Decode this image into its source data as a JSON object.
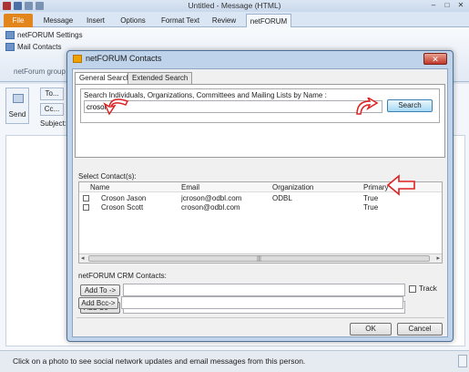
{
  "window": {
    "title": "Untitled - Message (HTML)",
    "controls": [
      "–",
      "□",
      "✕"
    ]
  },
  "ribbon": {
    "tabs": [
      "File",
      "Message",
      "Insert",
      "Options",
      "Format Text",
      "Review",
      "netFORUM"
    ],
    "items": [
      "netFORUM Settings",
      "Mail Contacts"
    ],
    "group_label": "netForum group"
  },
  "compose": {
    "send": "Send",
    "to": "To...",
    "cc": "Cc...",
    "subject": "Subject:"
  },
  "status": {
    "text": "Click on a photo to see social network updates and email messages from this person."
  },
  "dialog": {
    "title": "netFORUM Contacts",
    "close": "✕",
    "tabs": [
      "General Search",
      "Extended Search"
    ],
    "search_label": "Search Individuals, Organizations, Committees and Mailing Lists by Name :",
    "search_value": "croson",
    "search_button": "Search",
    "contacts_label": "Select Contact(s):",
    "columns": [
      "Name",
      "Email",
      "Organization",
      "Primary"
    ],
    "rows": [
      {
        "name": "Croson Jason",
        "email": "jcroson@odbl.com",
        "org": "ODBL",
        "primary": "True"
      },
      {
        "name": "Croson Scott",
        "email": "croson@odbl.com",
        "org": "",
        "primary": "True"
      }
    ],
    "scroll_left": "◂",
    "scroll_mid": "|||",
    "scroll_right": "▸",
    "crm_label": "netFORUM CRM Contacts:",
    "add_to": "Add To ->",
    "add_cc": "Add Cc- >",
    "add_bcc": "Add Bcc->",
    "track": "Track",
    "ok": "OK",
    "cancel": "Cancel"
  }
}
